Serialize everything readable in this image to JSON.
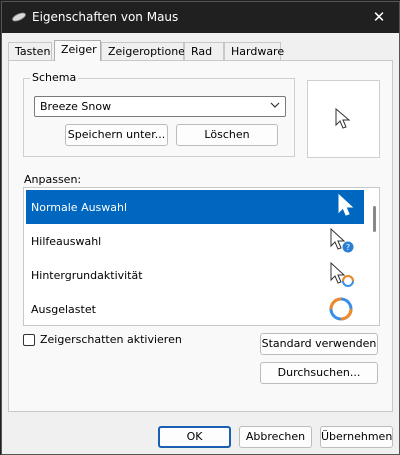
{
  "window": {
    "title": "Eigenschaften von Maus",
    "close_glyph": "✕",
    "icon": "mouse-icon"
  },
  "tabs": [
    {
      "label": "Tasten",
      "active": false
    },
    {
      "label": "Zeiger",
      "active": true
    },
    {
      "label": "Zeigeroptionen",
      "active": false
    },
    {
      "label": "Rad",
      "active": false
    },
    {
      "label": "Hardware",
      "active": false
    }
  ],
  "schema": {
    "group_label": "Schema",
    "selected": "Breeze Snow",
    "save_button": "Speichern unter...",
    "delete_button": "Löschen"
  },
  "customize": {
    "label": "Anpassen:",
    "items": [
      {
        "label": "Normale Auswahl",
        "icon": "arrow-cursor-icon",
        "selected": true
      },
      {
        "label": "Hilfeauswahl",
        "icon": "help-cursor-icon",
        "selected": false
      },
      {
        "label": "Hintergrundaktivität",
        "icon": "working-in-background-cursor-icon",
        "selected": false
      },
      {
        "label": "Ausgelastet",
        "icon": "busy-cursor-icon",
        "selected": false
      }
    ]
  },
  "shadow_checkbox": {
    "label": "Zeigerschatten aktivieren",
    "checked": false
  },
  "buttons": {
    "use_default": "Standard verwenden",
    "browse": "Durchsuchen...",
    "ok": "OK",
    "cancel": "Abbrechen",
    "apply": "Übernehmen"
  },
  "colors": {
    "selection": "#0067c0",
    "help_badge": "#2a7fd4",
    "busy_ring_blue": "#3a8ee6",
    "busy_ring_orange": "#f08a24"
  }
}
